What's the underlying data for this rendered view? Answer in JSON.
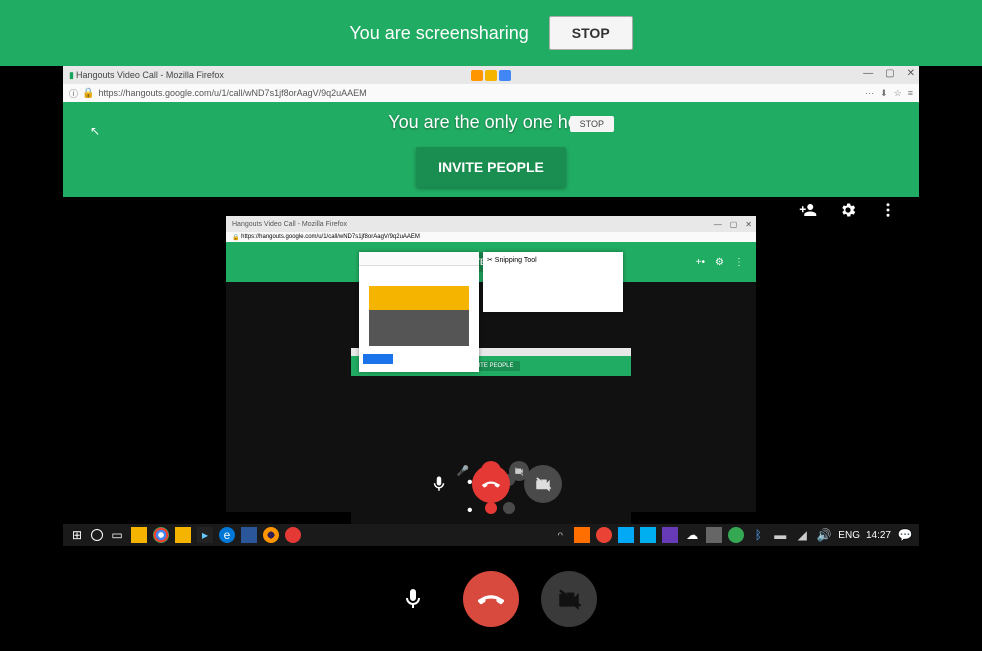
{
  "banner": {
    "text": "You are screensharing",
    "stop": "STOP"
  },
  "browser": {
    "tab_title": "Hangouts Video Call - Mozilla Firefox",
    "url": "https://hangouts.google.com/u/1/call/wND7s1jf8orAagV/9q2uAAEM",
    "min": "—",
    "max": "▢",
    "close": "✕"
  },
  "call": {
    "only_text": "You are the only one here",
    "invite": "INVITE PEOPLE",
    "stop_small": "STOP",
    "snip_title": "✂ Snipping Tool"
  },
  "taskbar": {
    "language": "ENG",
    "time": "14:27"
  },
  "inner_browser": {
    "tab_title": "Hangouts Video Call - Mozilla Firefox",
    "url": "https://hangouts.google.com/u/1/call/wND7s1jf8orAagV/9q2uAAEM"
  }
}
